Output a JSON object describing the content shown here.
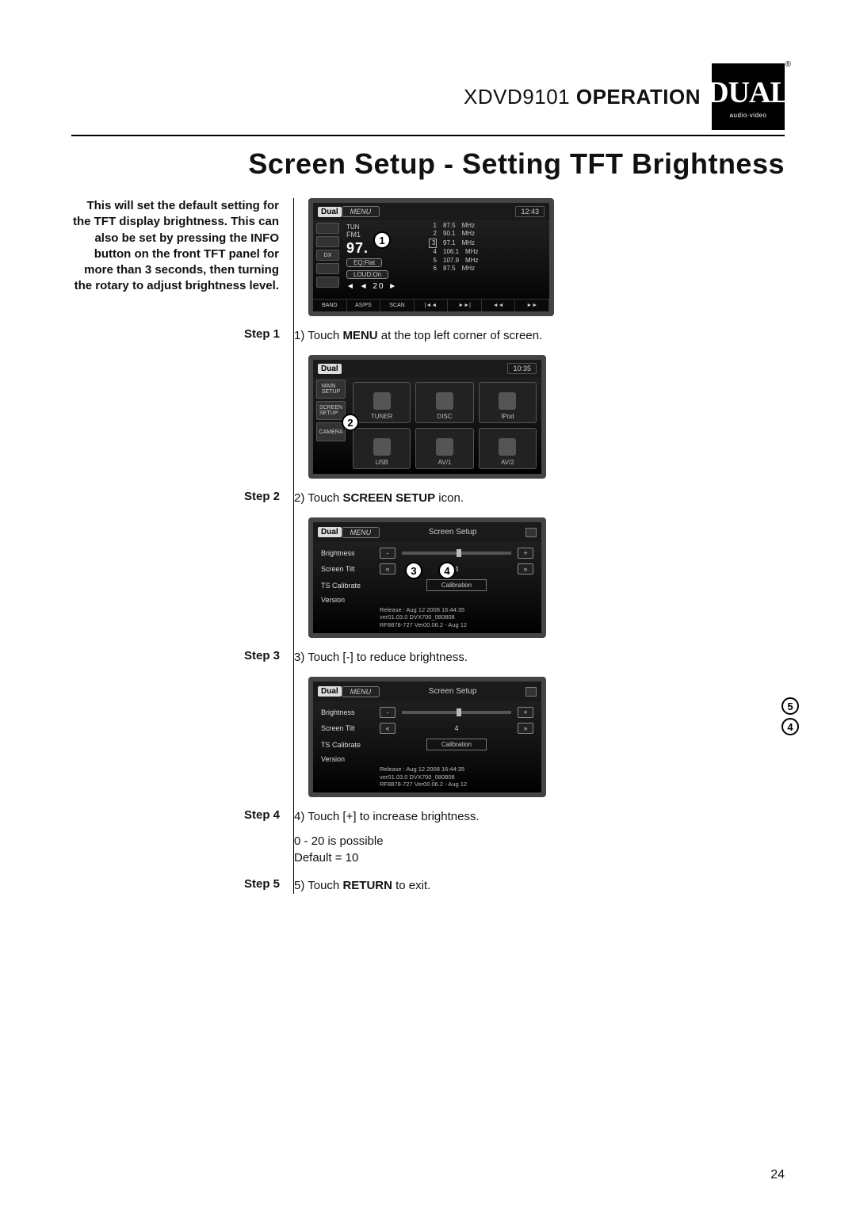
{
  "header": {
    "product": "XDVD9101",
    "word": "OPERATION",
    "logo_main": "DUAL",
    "logo_sub": "audio·video",
    "reg": "®"
  },
  "title": "Screen Setup - Setting TFT Brightness",
  "intro": "This will set the default setting for the TFT display brightness. This can also be set by pressing the INFO button on the front TFT panel for more than 3 seconds, then turning the rotary to adjust brightness level.",
  "steps": {
    "s1_label": "Step 1",
    "s1_pre": "1) Touch ",
    "s1_b": "MENU",
    "s1_post": " at the top left corner of screen.",
    "s2_label": "Step 2",
    "s2_pre": "2) Touch ",
    "s2_b": "SCREEN SETUP",
    "s2_post": " icon.",
    "s3_label": "Step 3",
    "s3_text": "3) Touch [-] to reduce brightness.",
    "s4_label": "Step 4",
    "s4_l1": "4) Touch [+] to increase brightness.",
    "s4_l2": "0 - 20 is possible",
    "s4_l3": "Default = 10",
    "s5_label": "Step 5",
    "s5_pre": "5) Touch ",
    "s5_b": "RETURN",
    "s5_post": " to exit."
  },
  "fig1": {
    "logo": "Dual",
    "menu": "MENU",
    "clock": "12:43",
    "tun": "TUN",
    "fm": "FM1",
    "dx": "DX",
    "freq_big": "97.",
    "eq": "EQ:Flat",
    "loud": "LOUD:On",
    "seek": "◄ ◄ 20 ►",
    "presets": [
      {
        "n": "1",
        "f": "87.5",
        "u": "MHz"
      },
      {
        "n": "2",
        "f": "90.1",
        "u": "MHz"
      },
      {
        "n": "3",
        "f": "97.1",
        "u": "MHz"
      },
      {
        "n": "4",
        "f": "106.1",
        "u": "MHz"
      },
      {
        "n": "5",
        "f": "107.9",
        "u": "MHz"
      },
      {
        "n": "6",
        "f": "87.5",
        "u": "MHz"
      }
    ],
    "controls": [
      "BAND",
      "AS/PS",
      "SCAN",
      "|◄◄",
      "►►|",
      "◄◄",
      "►►"
    ],
    "callout": "1"
  },
  "fig2": {
    "logo": "Dual",
    "clock": "10:35",
    "side": [
      "MAIN\nSETUP",
      "SCREEN\nSETUP",
      "CAMERA"
    ],
    "tiles": [
      "TUNER",
      "DISC",
      "IPod",
      "USB",
      "AV/1",
      "AV/2"
    ],
    "callout": "2"
  },
  "fig3": {
    "logo": "Dual",
    "menu": "MENU",
    "title": "Screen  Setup",
    "rows": {
      "brightness": "Brightness",
      "tilt": "Screen Tilt",
      "ts": "TS Calibrate",
      "ver": "Version",
      "tilt_val": "4",
      "calib": "Calibration"
    },
    "version_lines": [
      "Release : Aug 12 2008    16:44:35",
      "ver01.03.0 DVX700_080808",
      "RF8878-727 Ver00.06.2 - Aug 12"
    ],
    "cal3": "3",
    "cal4": "4"
  },
  "fig4": {
    "logo": "Dual",
    "menu": "MENU",
    "title": "Screen  Setup",
    "rows": {
      "brightness": "Brightness",
      "tilt": "Screen Tilt",
      "ts": "TS Calibrate",
      "ver": "Version",
      "tilt_val": "4",
      "calib": "Calibration"
    },
    "version_lines": [
      "Release : Aug 12 2008    16:44:35",
      "ver01.03.0 DVX700_080808",
      "RF8878-727 Ver00.06.2 - Aug 12"
    ],
    "cal5": "5",
    "cal4": "4"
  },
  "page_number": "24"
}
